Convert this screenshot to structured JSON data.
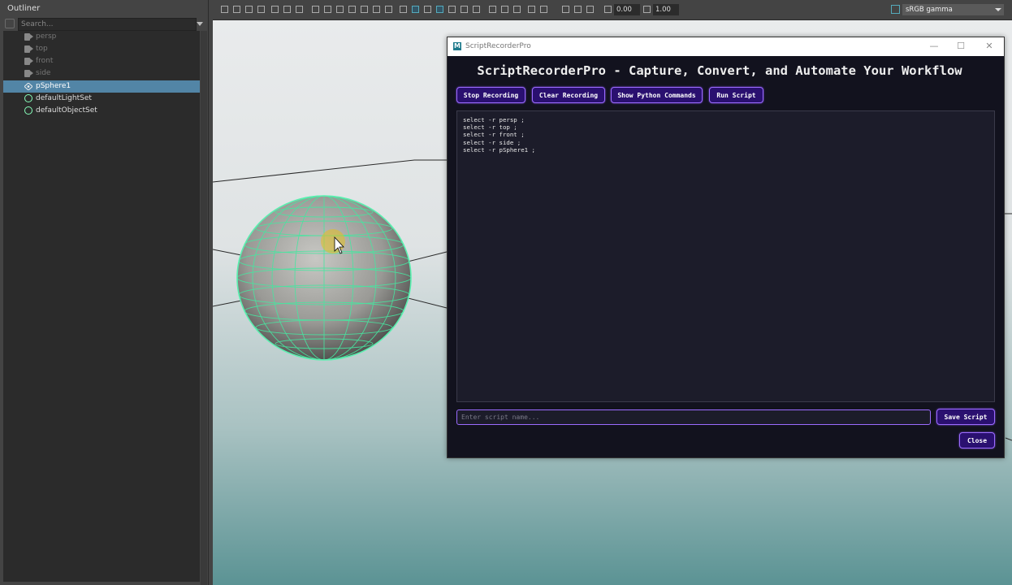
{
  "outliner": {
    "title": "Outliner",
    "search_placeholder": "Search...",
    "items": [
      {
        "label": "persp",
        "kind": "camera",
        "dim": true
      },
      {
        "label": "top",
        "kind": "camera",
        "dim": true
      },
      {
        "label": "front",
        "kind": "camera",
        "dim": true
      },
      {
        "label": "side",
        "kind": "camera",
        "dim": true
      },
      {
        "label": "pSphere1",
        "kind": "mesh",
        "selected": true
      },
      {
        "label": "defaultLightSet",
        "kind": "set"
      },
      {
        "label": "defaultObjectSet",
        "kind": "set"
      }
    ]
  },
  "toolbar": {
    "value_a": "0.00",
    "value_b": "1.00",
    "colorspace": "sRGB gamma"
  },
  "window": {
    "title": "ScriptRecorderPro",
    "minimize_icon": "minimize-icon",
    "maximize_icon": "maximize-icon",
    "close_icon": "close-icon",
    "heading": "ScriptRecorderPro - Capture, Convert, and Automate Your Workflow",
    "buttons": {
      "stop": "Stop Recording",
      "clear": "Clear Recording",
      "python": "Show Python Commands",
      "run": "Run Script",
      "save": "Save Script",
      "close": "Close"
    },
    "script_lines": [
      "select -r persp ;",
      "select -r top ;",
      "select -r front ;",
      "select -r side ;",
      "select -r pSphere1 ;"
    ],
    "name_placeholder": "Enter script name..."
  },
  "colors": {
    "accent": "#9b6bff",
    "button_bg": "#2a1070",
    "window_bg": "#12121e",
    "selection": "#5285a6",
    "wireframe": "#47e6a0"
  }
}
